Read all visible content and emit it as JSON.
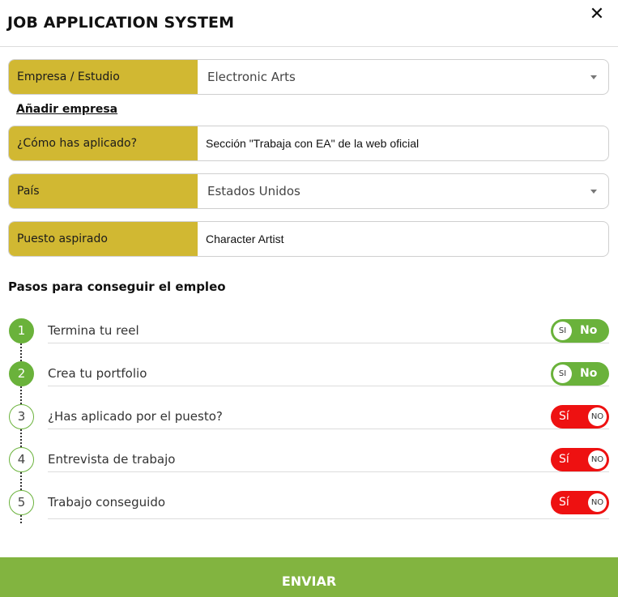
{
  "header": {
    "title": "JOB APPLICATION SYSTEM",
    "close_glyph": "✕",
    "close_icon": "close-icon"
  },
  "form": {
    "company": {
      "label": "Empresa / Estudio",
      "value": "Electronic Arts"
    },
    "add_company": "Añadir empresa",
    "how_applied": {
      "label": "¿Cómo has aplicado?",
      "value": "Sección \"Trabaja con EA\" de la web oficial"
    },
    "country": {
      "label": "País",
      "value": "Estados Unidos"
    },
    "position": {
      "label": "Puesto aspirado",
      "value": "Character Artist"
    }
  },
  "steps_title": "Pasos para conseguir el empleo",
  "steps": [
    {
      "num": "1",
      "name": "Termina tu reel",
      "done": true,
      "knob": "SI",
      "side": "No"
    },
    {
      "num": "2",
      "name": "Crea tu portfolio",
      "done": true,
      "knob": "SI",
      "side": "No"
    },
    {
      "num": "3",
      "name": "¿Has aplicado por el puesto?",
      "done": false,
      "knob": "NO",
      "side": "Sí"
    },
    {
      "num": "4",
      "name": "Entrevista de trabajo",
      "done": false,
      "knob": "NO",
      "side": "Sí"
    },
    {
      "num": "5",
      "name": "Trabajo conseguido",
      "done": false,
      "knob": "NO",
      "side": "Sí"
    }
  ],
  "submit_label": "ENVIAR",
  "colors": {
    "gold": "#d1b832",
    "green": "#6ab23b",
    "red": "#ee1111",
    "submit": "#82b440"
  }
}
